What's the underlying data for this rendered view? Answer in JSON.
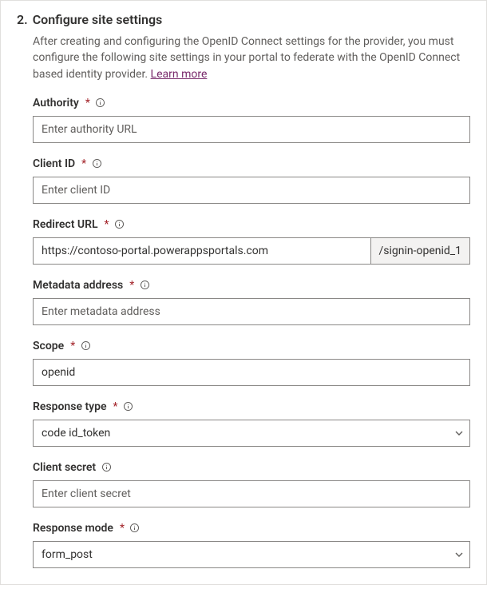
{
  "step": {
    "number": "2.",
    "title": "Configure site settings"
  },
  "description": "After creating and configuring the OpenID Connect settings for the provider, you must configure the following site settings in your portal to federate with the OpenID Connect based identity provider.",
  "learn_more": "Learn more",
  "required_marker": "*",
  "fields": {
    "authority": {
      "label": "Authority",
      "placeholder": "Enter authority URL",
      "value": ""
    },
    "client_id": {
      "label": "Client ID",
      "placeholder": "Enter client ID",
      "value": ""
    },
    "redirect_url": {
      "label": "Redirect URL",
      "value": "https://contoso-portal.powerappsportals.com",
      "suffix": "/signin-openid_1"
    },
    "metadata": {
      "label": "Metadata address",
      "placeholder": "Enter metadata address",
      "value": ""
    },
    "scope": {
      "label": "Scope",
      "value": "openid"
    },
    "response_type": {
      "label": "Response type",
      "value": "code id_token"
    },
    "client_secret": {
      "label": "Client secret",
      "placeholder": "Enter client secret",
      "value": ""
    },
    "response_mode": {
      "label": "Response mode",
      "value": "form_post"
    }
  }
}
